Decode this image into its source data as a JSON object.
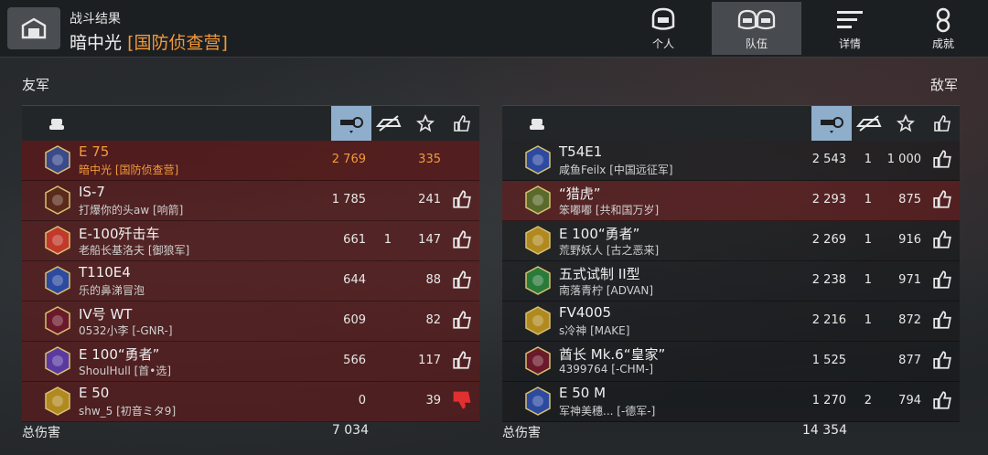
{
  "header": {
    "subtitle": "战斗结果",
    "player": "暗中光",
    "clan": "[国防侦查营]"
  },
  "tabs": [
    {
      "label": "个人",
      "active": false
    },
    {
      "label": "队伍",
      "active": true
    },
    {
      "label": "详情",
      "active": false
    },
    {
      "label": "成就",
      "active": false
    }
  ],
  "allies": {
    "title": "友军",
    "total_label": "总伤害",
    "total": "7 034",
    "rows": [
      {
        "tank": "E 75",
        "player": "暗中光 [国防侦查营]",
        "damage": "2 769",
        "kills": "",
        "score": "335",
        "like": "none",
        "self": true
      },
      {
        "tank": "IS-7",
        "player": "打爆你的头aw [响箭]",
        "damage": "1 785",
        "kills": "",
        "score": "241",
        "like": "up"
      },
      {
        "tank": "E-100歼击车",
        "player": "老船长基洛夫 [御狼军]",
        "damage": "661",
        "kills": "1",
        "score": "147",
        "like": "up"
      },
      {
        "tank": "T110E4",
        "player": "乐的鼻涕冒泡",
        "damage": "644",
        "kills": "",
        "score": "88",
        "like": "up"
      },
      {
        "tank": "IV号 WT",
        "player": "0532小李 [-GNR-]",
        "damage": "609",
        "kills": "",
        "score": "82",
        "like": "up"
      },
      {
        "tank": "E 100“勇者”",
        "player": "ShoulHull [首•选]",
        "damage": "566",
        "kills": "",
        "score": "117",
        "like": "up"
      },
      {
        "tank": "E 50",
        "player": "shw_5 [初音ミタ9]",
        "damage": "0",
        "kills": "",
        "score": "39",
        "like": "down"
      }
    ]
  },
  "enemies": {
    "title": "敌军",
    "total_label": "总伤害",
    "total": "14 354",
    "rows": [
      {
        "tank": "T54E1",
        "player": "咸鱼Feilx [中国远征军]",
        "damage": "2 543",
        "kills": "1",
        "score": "1 000",
        "like": "up"
      },
      {
        "tank": "“猎虎”",
        "player": "笨嘟嘟 [共和国万岁]",
        "damage": "2 293",
        "kills": "1",
        "score": "875",
        "like": "up",
        "hl": true
      },
      {
        "tank": "E 100“勇者”",
        "player": "荒野妖人 [古之恶来]",
        "damage": "2 269",
        "kills": "1",
        "score": "916",
        "like": "up"
      },
      {
        "tank": "五式试制 II型",
        "player": "南落青柠 [ADVAN]",
        "damage": "2 238",
        "kills": "1",
        "score": "971",
        "like": "up"
      },
      {
        "tank": "FV4005",
        "player": "s冷神 [MAKE]",
        "damage": "2 216",
        "kills": "1",
        "score": "872",
        "like": "up"
      },
      {
        "tank": "酋长 Mk.6“皇家”",
        "player": "4399764 [-CHM-]",
        "damage": "1 525",
        "kills": "",
        "score": "877",
        "like": "up"
      },
      {
        "tank": "E 50 M",
        "player": "军神美穗... [-德军-]",
        "damage": "1 270",
        "kills": "2",
        "score": "794",
        "like": "up"
      }
    ]
  },
  "emblems_allies": [
    "#3a4a8a",
    "#5a2a1a",
    "#c0392b",
    "#2c4aa0",
    "#6a1a2a",
    "#5a3aa0",
    "#b08a20"
  ],
  "emblems_enemies": [
    "#2c4aa0",
    "#5a6a2a",
    "#b08a20",
    "#2a7a3a",
    "#b08a20",
    "#6a1a2a",
    "#2c4aa0"
  ],
  "colors": {
    "accent_orange": "#f29a3c",
    "dislike_red": "#e03030",
    "sort_highlight": "#8faecb"
  }
}
